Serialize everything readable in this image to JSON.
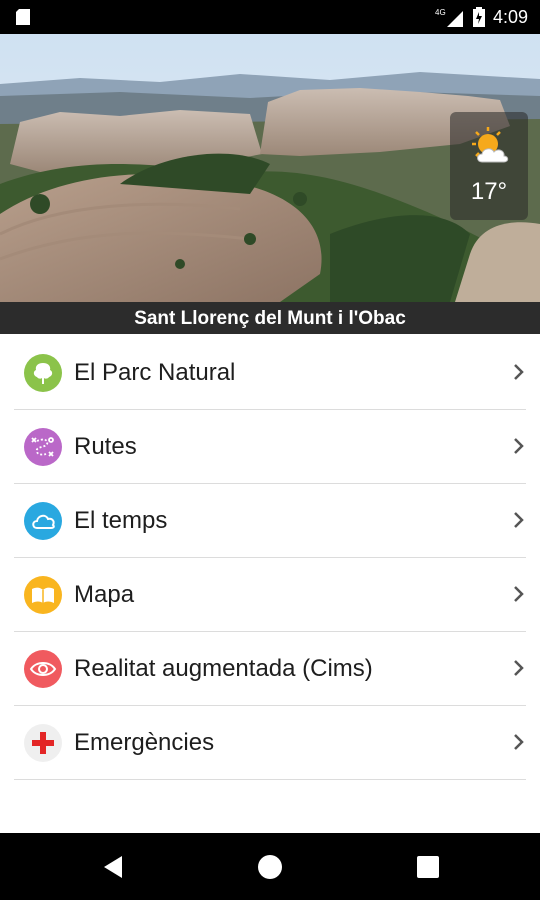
{
  "status_bar": {
    "time": "4:09",
    "network": "4G"
  },
  "hero": {
    "caption": "Sant Llorenç del Munt i l'Obac",
    "weather": {
      "temperature": "17°",
      "icon": "sun-cloud-icon"
    }
  },
  "menu": {
    "items": [
      {
        "label": "El Parc Natural",
        "icon": "tree-icon",
        "color": "#8bc34a"
      },
      {
        "label": "Rutes",
        "icon": "route-icon",
        "color": "#ba68c8"
      },
      {
        "label": "El temps",
        "icon": "cloud-icon",
        "color": "#29a8e0"
      },
      {
        "label": "Mapa",
        "icon": "map-book-icon",
        "color": "#f9b51f"
      },
      {
        "label": "Realitat augmentada (Cims)",
        "icon": "eye-target-icon",
        "color": "#f05a5f"
      },
      {
        "label": "Emergències",
        "icon": "red-cross-icon",
        "color": "#e32626"
      }
    ]
  }
}
